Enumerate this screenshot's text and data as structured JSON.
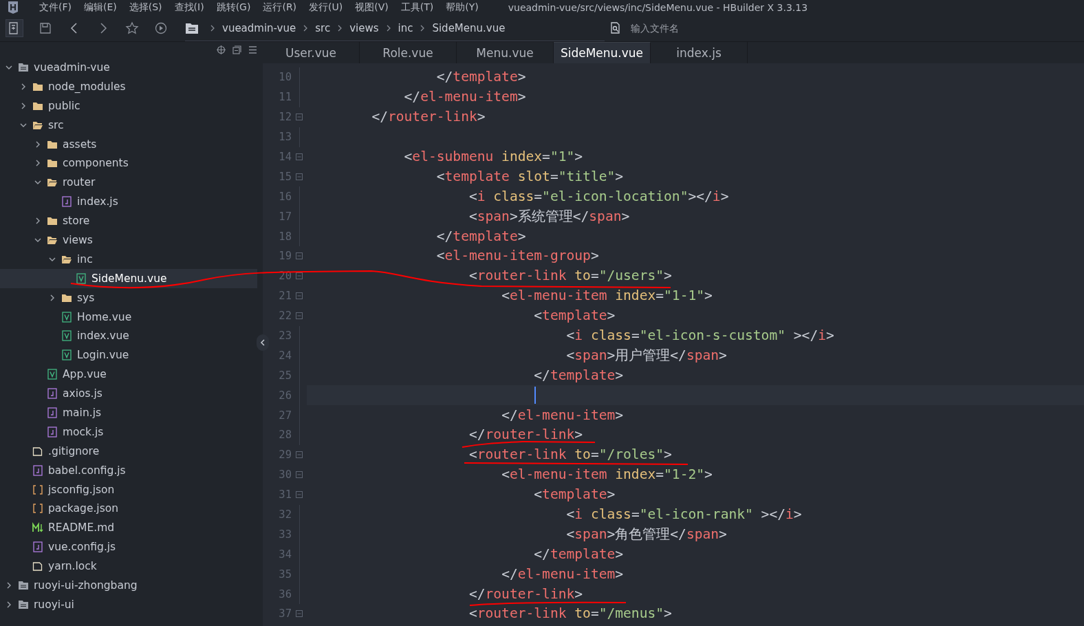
{
  "window": {
    "title": "vueadmin-vue/src/views/inc/SideMenu.vue - HBuilder X 3.3.13"
  },
  "menu": [
    "文件(F)",
    "编辑(E)",
    "选择(S)",
    "查找(I)",
    "跳转(G)",
    "运行(R)",
    "发行(U)",
    "视图(V)",
    "工具(T)",
    "帮助(Y)"
  ],
  "breadcrumb": [
    "vueadmin-vue",
    "src",
    "views",
    "inc",
    "SideMenu.vue"
  ],
  "search": {
    "placeholder": "输入文件名"
  },
  "tree": [
    {
      "label": "vueadmin-vue",
      "kind": "project",
      "expanded": true,
      "selected": false,
      "children": [
        {
          "label": "node_modules",
          "kind": "folder",
          "expanded": false,
          "selected": false
        },
        {
          "label": "public",
          "kind": "folder",
          "expanded": false,
          "selected": false
        },
        {
          "label": "src",
          "kind": "folder",
          "expanded": true,
          "selected": false,
          "children": [
            {
              "label": "assets",
              "kind": "folder",
              "expanded": false,
              "selected": false
            },
            {
              "label": "components",
              "kind": "folder",
              "expanded": false,
              "selected": false
            },
            {
              "label": "router",
              "kind": "folder",
              "expanded": true,
              "selected": false,
              "children": [
                {
                  "label": "index.js",
                  "kind": "js",
                  "selected": false
                }
              ]
            },
            {
              "label": "store",
              "kind": "folder",
              "expanded": false,
              "selected": false
            },
            {
              "label": "views",
              "kind": "folder",
              "expanded": true,
              "selected": false,
              "children": [
                {
                  "label": "inc",
                  "kind": "folder",
                  "expanded": true,
                  "selected": false,
                  "children": [
                    {
                      "label": "SideMenu.vue",
                      "kind": "vue",
                      "selected": true
                    }
                  ]
                },
                {
                  "label": "sys",
                  "kind": "folder",
                  "expanded": false,
                  "selected": false
                },
                {
                  "label": "Home.vue",
                  "kind": "vue",
                  "selected": false
                },
                {
                  "label": "index.vue",
                  "kind": "vue",
                  "selected": false
                },
                {
                  "label": "Login.vue",
                  "kind": "vue",
                  "selected": false
                }
              ]
            },
            {
              "label": "App.vue",
              "kind": "vue",
              "selected": false
            },
            {
              "label": "axios.js",
              "kind": "js",
              "selected": false
            },
            {
              "label": "main.js",
              "kind": "js",
              "selected": false
            },
            {
              "label": "mock.js",
              "kind": "js",
              "selected": false
            }
          ]
        },
        {
          "label": ".gitignore",
          "kind": "file",
          "selected": false
        },
        {
          "label": "babel.config.js",
          "kind": "js",
          "selected": false
        },
        {
          "label": "jsconfig.json",
          "kind": "json",
          "selected": false
        },
        {
          "label": "package.json",
          "kind": "json",
          "selected": false
        },
        {
          "label": "README.md",
          "kind": "md",
          "selected": false
        },
        {
          "label": "vue.config.js",
          "kind": "js",
          "selected": false
        },
        {
          "label": "yarn.lock",
          "kind": "file",
          "selected": false
        }
      ]
    },
    {
      "label": "ruoyi-ui-zhongbang",
      "kind": "project",
      "expanded": false,
      "selected": false
    },
    {
      "label": "ruoyi-ui",
      "kind": "project",
      "expanded": false,
      "selected": false
    }
  ],
  "tabs": [
    {
      "label": "User.vue",
      "selected": false
    },
    {
      "label": "Role.vue",
      "selected": false
    },
    {
      "label": "Menu.vue",
      "selected": false
    },
    {
      "label": "SideMenu.vue",
      "selected": true
    },
    {
      "label": "index.js",
      "selected": false
    }
  ],
  "code": [
    {
      "number": "10",
      "fold": false,
      "current": false,
      "tokens": [
        {
          "kind": "punct",
          "text": "                </"
        },
        {
          "kind": "tag",
          "text": "template"
        },
        {
          "kind": "punct",
          "text": ">"
        }
      ]
    },
    {
      "number": "11",
      "fold": false,
      "current": false,
      "tokens": [
        {
          "kind": "punct",
          "text": "            </"
        },
        {
          "kind": "tag",
          "text": "el-menu-item"
        },
        {
          "kind": "punct",
          "text": ">"
        }
      ]
    },
    {
      "number": "12",
      "fold": true,
      "current": false,
      "tokens": [
        {
          "kind": "punct",
          "text": "        </"
        },
        {
          "kind": "tag",
          "text": "router-link"
        },
        {
          "kind": "punct",
          "text": ">"
        }
      ]
    },
    {
      "number": "13",
      "fold": false,
      "current": false
    },
    {
      "number": "14",
      "fold": true,
      "current": false,
      "tokens": [
        {
          "kind": "punct",
          "text": "            <"
        },
        {
          "kind": "tag",
          "text": "el-submenu"
        },
        {
          "kind": "attr",
          "text": " index"
        },
        {
          "kind": "punct",
          "text": "="
        },
        {
          "kind": "string",
          "text": "\"1\""
        },
        {
          "kind": "punct",
          "text": ">"
        }
      ]
    },
    {
      "number": "15",
      "fold": true,
      "current": false,
      "tokens": [
        {
          "kind": "punct",
          "text": "                <"
        },
        {
          "kind": "tag",
          "text": "template"
        },
        {
          "kind": "attr",
          "text": " slot"
        },
        {
          "kind": "punct",
          "text": "="
        },
        {
          "kind": "string",
          "text": "\"title\""
        },
        {
          "kind": "punct",
          "text": ">"
        }
      ]
    },
    {
      "number": "16",
      "fold": false,
      "current": false,
      "tokens": [
        {
          "kind": "punct",
          "text": "                    <"
        },
        {
          "kind": "tag",
          "text": "i"
        },
        {
          "kind": "attr",
          "text": " class"
        },
        {
          "kind": "punct",
          "text": "="
        },
        {
          "kind": "string",
          "text": "\"el-icon-location\""
        },
        {
          "kind": "punct",
          "text": "></"
        },
        {
          "kind": "tag",
          "text": "i"
        },
        {
          "kind": "punct",
          "text": ">"
        }
      ]
    },
    {
      "number": "17",
      "fold": false,
      "current": false,
      "tokens": [
        {
          "kind": "punct",
          "text": "                    <"
        },
        {
          "kind": "tag",
          "text": "span"
        },
        {
          "kind": "punct",
          "text": ">"
        },
        {
          "kind": "text",
          "text": "系统管理"
        },
        {
          "kind": "punct",
          "text": "</"
        },
        {
          "kind": "tag",
          "text": "span"
        },
        {
          "kind": "punct",
          "text": ">"
        }
      ]
    },
    {
      "number": "18",
      "fold": false,
      "current": false,
      "tokens": [
        {
          "kind": "punct",
          "text": "                </"
        },
        {
          "kind": "tag",
          "text": "template"
        },
        {
          "kind": "punct",
          "text": ">"
        }
      ]
    },
    {
      "number": "19",
      "fold": true,
      "current": false,
      "tokens": [
        {
          "kind": "punct",
          "text": "                <"
        },
        {
          "kind": "tag",
          "text": "el-menu-item-group"
        },
        {
          "kind": "punct",
          "text": ">"
        }
      ]
    },
    {
      "number": "20",
      "fold": true,
      "current": false,
      "tokens": [
        {
          "kind": "punct",
          "text": "                    <"
        },
        {
          "kind": "tag",
          "text": "router-link"
        },
        {
          "kind": "attr",
          "text": " to"
        },
        {
          "kind": "punct",
          "text": "="
        },
        {
          "kind": "string",
          "text": "\"/users\""
        },
        {
          "kind": "punct",
          "text": ">"
        }
      ]
    },
    {
      "number": "21",
      "fold": true,
      "current": false,
      "tokens": [
        {
          "kind": "punct",
          "text": "                        <"
        },
        {
          "kind": "tag",
          "text": "el-menu-item"
        },
        {
          "kind": "attr",
          "text": " index"
        },
        {
          "kind": "punct",
          "text": "="
        },
        {
          "kind": "string",
          "text": "\"1-1\""
        },
        {
          "kind": "punct",
          "text": ">"
        }
      ]
    },
    {
      "number": "22",
      "fold": true,
      "current": false,
      "tokens": [
        {
          "kind": "punct",
          "text": "                            <"
        },
        {
          "kind": "tag",
          "text": "template"
        },
        {
          "kind": "punct",
          "text": ">"
        }
      ]
    },
    {
      "number": "23",
      "fold": false,
      "current": false,
      "tokens": [
        {
          "kind": "punct",
          "text": "                                <"
        },
        {
          "kind": "tag",
          "text": "i"
        },
        {
          "kind": "attr",
          "text": " class"
        },
        {
          "kind": "punct",
          "text": "="
        },
        {
          "kind": "string",
          "text": "\"el-icon-s-custom\""
        },
        {
          "kind": "punct",
          "text": " ></"
        },
        {
          "kind": "tag",
          "text": "i"
        },
        {
          "kind": "punct",
          "text": ">"
        }
      ]
    },
    {
      "number": "24",
      "fold": false,
      "current": false,
      "tokens": [
        {
          "kind": "punct",
          "text": "                                <"
        },
        {
          "kind": "tag",
          "text": "span"
        },
        {
          "kind": "punct",
          "text": ">"
        },
        {
          "kind": "text",
          "text": "用户管理"
        },
        {
          "kind": "punct",
          "text": "</"
        },
        {
          "kind": "tag",
          "text": "span"
        },
        {
          "kind": "punct",
          "text": ">"
        }
      ]
    },
    {
      "number": "25",
      "fold": false,
      "current": false,
      "tokens": [
        {
          "kind": "punct",
          "text": "                            </"
        },
        {
          "kind": "tag",
          "text": "template"
        },
        {
          "kind": "punct",
          "text": ">"
        }
      ]
    },
    {
      "number": "26",
      "fold": false,
      "current": true
    },
    {
      "number": "27",
      "fold": false,
      "current": false,
      "tokens": [
        {
          "kind": "punct",
          "text": "                        </"
        },
        {
          "kind": "tag",
          "text": "el-menu-item"
        },
        {
          "kind": "punct",
          "text": ">"
        }
      ]
    },
    {
      "number": "28",
      "fold": false,
      "current": false,
      "tokens": [
        {
          "kind": "punct",
          "text": "                    </"
        },
        {
          "kind": "tag",
          "text": "router-link"
        },
        {
          "kind": "punct",
          "text": ">"
        }
      ]
    },
    {
      "number": "29",
      "fold": true,
      "current": false,
      "tokens": [
        {
          "kind": "punct",
          "text": "                    <"
        },
        {
          "kind": "tag",
          "text": "router-link"
        },
        {
          "kind": "attr",
          "text": " to"
        },
        {
          "kind": "punct",
          "text": "="
        },
        {
          "kind": "string",
          "text": "\"/roles\""
        },
        {
          "kind": "punct",
          "text": ">"
        }
      ]
    },
    {
      "number": "30",
      "fold": true,
      "current": false,
      "tokens": [
        {
          "kind": "punct",
          "text": "                        <"
        },
        {
          "kind": "tag",
          "text": "el-menu-item"
        },
        {
          "kind": "attr",
          "text": " index"
        },
        {
          "kind": "punct",
          "text": "="
        },
        {
          "kind": "string",
          "text": "\"1-2\""
        },
        {
          "kind": "punct",
          "text": ">"
        }
      ]
    },
    {
      "number": "31",
      "fold": true,
      "current": false,
      "tokens": [
        {
          "kind": "punct",
          "text": "                            <"
        },
        {
          "kind": "tag",
          "text": "template"
        },
        {
          "kind": "punct",
          "text": ">"
        }
      ]
    },
    {
      "number": "32",
      "fold": false,
      "current": false,
      "tokens": [
        {
          "kind": "punct",
          "text": "                                <"
        },
        {
          "kind": "tag",
          "text": "i"
        },
        {
          "kind": "attr",
          "text": " class"
        },
        {
          "kind": "punct",
          "text": "="
        },
        {
          "kind": "string",
          "text": "\"el-icon-rank\""
        },
        {
          "kind": "punct",
          "text": " ></"
        },
        {
          "kind": "tag",
          "text": "i"
        },
        {
          "kind": "punct",
          "text": ">"
        }
      ]
    },
    {
      "number": "33",
      "fold": false,
      "current": false,
      "tokens": [
        {
          "kind": "punct",
          "text": "                                <"
        },
        {
          "kind": "tag",
          "text": "span"
        },
        {
          "kind": "punct",
          "text": ">"
        },
        {
          "kind": "text",
          "text": "角色管理"
        },
        {
          "kind": "punct",
          "text": "</"
        },
        {
          "kind": "tag",
          "text": "span"
        },
        {
          "kind": "punct",
          "text": ">"
        }
      ]
    },
    {
      "number": "34",
      "fold": false,
      "current": false,
      "tokens": [
        {
          "kind": "punct",
          "text": "                            </"
        },
        {
          "kind": "tag",
          "text": "template"
        },
        {
          "kind": "punct",
          "text": ">"
        }
      ]
    },
    {
      "number": "35",
      "fold": false,
      "current": false,
      "tokens": [
        {
          "kind": "punct",
          "text": "                        </"
        },
        {
          "kind": "tag",
          "text": "el-menu-item"
        },
        {
          "kind": "punct",
          "text": ">"
        }
      ]
    },
    {
      "number": "36",
      "fold": false,
      "current": false,
      "tokens": [
        {
          "kind": "punct",
          "text": "                    </"
        },
        {
          "kind": "tag",
          "text": "router-link"
        },
        {
          "kind": "punct",
          "text": ">"
        }
      ]
    },
    {
      "number": "37",
      "fold": true,
      "current": false,
      "tokens": [
        {
          "kind": "punct",
          "text": "                    <"
        },
        {
          "kind": "tag",
          "text": "router-link"
        },
        {
          "kind": "attr",
          "text": " to"
        },
        {
          "kind": "punct",
          "text": "="
        },
        {
          "kind": "string",
          "text": "\"/menus\""
        },
        {
          "kind": "punct",
          "text": ">"
        }
      ]
    }
  ]
}
